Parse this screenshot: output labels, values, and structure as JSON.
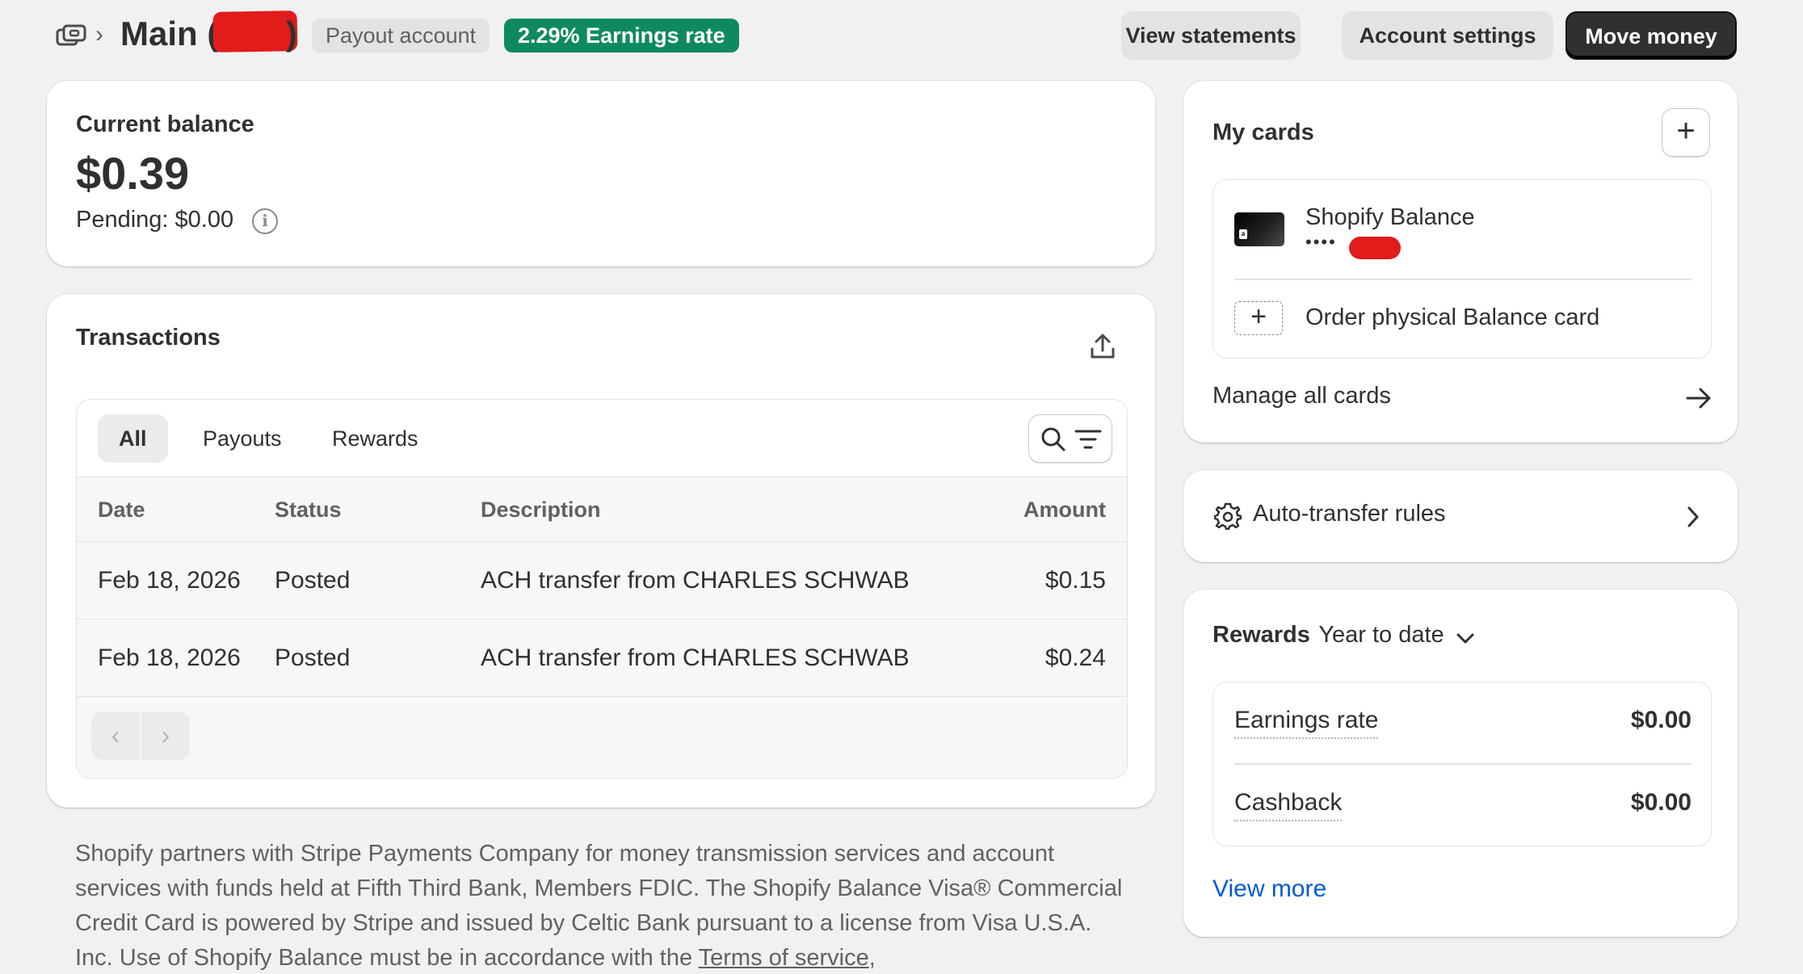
{
  "header": {
    "breadcrumb_separator": "›",
    "title_prefix": "Main (",
    "title_suffix": ")",
    "badges": {
      "payout": "Payout account",
      "earnings_rate": "2.29% Earnings rate"
    },
    "buttons": {
      "view_statements": "View statements",
      "account_settings": "Account settings",
      "move_money": "Move money"
    }
  },
  "balance": {
    "label": "Current balance",
    "amount": "$0.39",
    "pending": "Pending: $0.00"
  },
  "transactions": {
    "title": "Transactions",
    "tabs": [
      "All",
      "Payouts",
      "Rewards"
    ],
    "active_tab": "All",
    "columns": [
      "Date",
      "Status",
      "Description",
      "Amount"
    ],
    "rows": [
      {
        "date": "Feb 18, 2026",
        "status": "Posted",
        "description": "ACH transfer from CHARLES SCHWAB",
        "amount": "$0.15"
      },
      {
        "date": "Feb 18, 2026",
        "status": "Posted",
        "description": "ACH transfer from CHARLES SCHWAB",
        "amount": "$0.24"
      }
    ]
  },
  "disclaimer": {
    "text": "Shopify partners with Stripe Payments Company for money transmission services and account services with funds held at Fifth Third Bank, Members FDIC. The Shopify Balance Visa® Commercial Credit Card is powered by Stripe and issued by Celtic Bank pursuant to a license from Visa U.S.A. Inc. Use of Shopify Balance must be in accordance with the ",
    "terms_link": "Terms of service",
    "trailing": ","
  },
  "cards": {
    "title": "My cards",
    "card_name": "Shopify Balance",
    "card_mask": "••••",
    "order_physical": "Order physical Balance card",
    "manage_all": "Manage all cards"
  },
  "auto_transfer": {
    "label": "Auto-transfer rules"
  },
  "rewards": {
    "title": "Rewards",
    "period": "Year to date",
    "items": [
      {
        "label": "Earnings rate",
        "value": "$0.00"
      },
      {
        "label": "Cashback",
        "value": "$0.00"
      }
    ],
    "view_more": "View more"
  },
  "colors": {
    "accent_green": "#0f8a5f",
    "link_blue": "#005bd3",
    "primary_button": "#303030",
    "redaction": "#e21b1b"
  }
}
